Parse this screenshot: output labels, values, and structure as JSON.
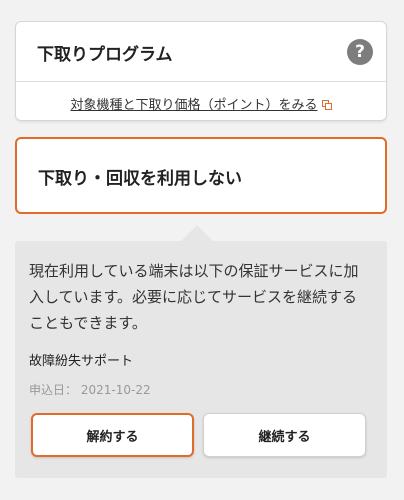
{
  "tradein": {
    "title": "下取りプログラム",
    "help_glyph": "?",
    "link_text": "対象機種と下取り価格（ポイント）をみる"
  },
  "no_tradein": {
    "title": "下取り・回収を利用しない"
  },
  "warranty": {
    "description": "現在利用している端末は以下の保証サービスに加入しています。必要に応じてサービスを継続することもできます。",
    "service_name": "故障紛失サポート",
    "date_label": "申込日：",
    "date_value": "2021-10-22",
    "cancel_label": "解約する",
    "continue_label": "継続する"
  },
  "colors": {
    "accent": "#e06c2a",
    "panel_bg": "#e6e6e6",
    "page_bg": "#f2f2f2",
    "help_bg": "#7d7d7d"
  }
}
